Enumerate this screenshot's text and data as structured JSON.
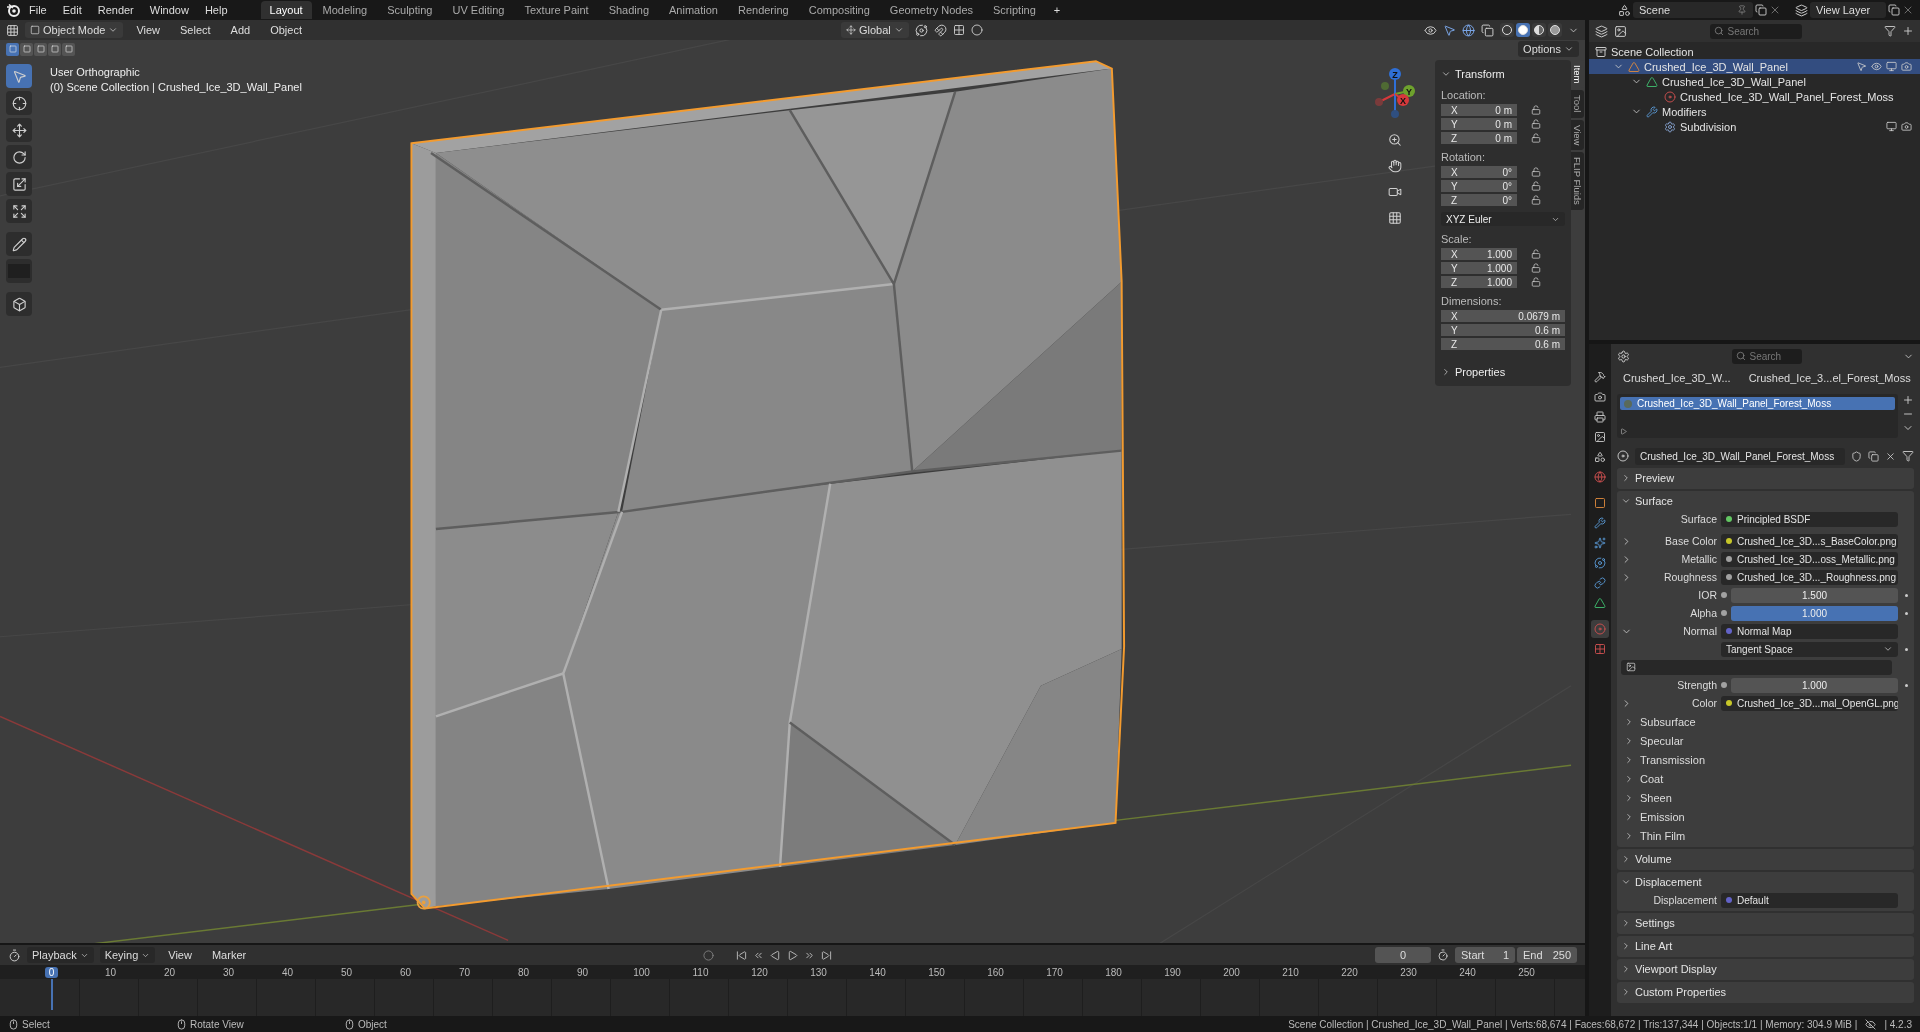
{
  "top_bar": {
    "menus": [
      "File",
      "Edit",
      "Render",
      "Window",
      "Help"
    ],
    "workspaces": [
      {
        "label": "Layout",
        "selected": true
      },
      {
        "label": "Modeling",
        "selected": false
      },
      {
        "label": "Sculpting",
        "selected": false
      },
      {
        "label": "UV Editing",
        "selected": false
      },
      {
        "label": "Texture Paint",
        "selected": false
      },
      {
        "label": "Shading",
        "selected": false
      },
      {
        "label": "Animation",
        "selected": false
      },
      {
        "label": "Rendering",
        "selected": false
      },
      {
        "label": "Compositing",
        "selected": false
      },
      {
        "label": "Geometry Nodes",
        "selected": false
      },
      {
        "label": "Scripting",
        "selected": false
      }
    ],
    "add_workspace": "+",
    "scene": "Scene",
    "view_layer": "View Layer"
  },
  "viewport": {
    "header": {
      "mode": "Object Mode",
      "menus": [
        "View",
        "Select",
        "Add",
        "Object"
      ],
      "orientation": "Global",
      "options": "Options"
    },
    "shading_modes": [
      {
        "kind": "wireframe",
        "selected": false
      },
      {
        "kind": "solid",
        "selected": true
      },
      {
        "kind": "material",
        "selected": false
      },
      {
        "kind": "rendered",
        "selected": false
      }
    ],
    "select_modes": [
      {
        "selected": true
      },
      {
        "selected": false
      },
      {
        "selected": false
      },
      {
        "selected": false
      },
      {
        "selected": false
      }
    ],
    "tools": [
      {
        "kind": "select",
        "selected": true
      },
      {
        "kind": "cursor",
        "selected": false
      },
      {
        "kind": "move",
        "selected": false
      },
      {
        "kind": "rotate",
        "selected": false
      },
      {
        "kind": "scale",
        "selected": false
      },
      {
        "kind": "transform",
        "selected": false
      },
      {
        "kind": "annotate",
        "selected": false
      },
      {
        "kind": "measure",
        "selected": false
      },
      {
        "kind": "add-cube",
        "selected": false
      }
    ],
    "view_name": "User Orthographic",
    "context": "(0) Scene Collection | Crushed_Ice_3D_Wall_Panel",
    "gizmo_axes": [
      {
        "label": "Z",
        "color": "#2f6fd6"
      },
      {
        "label": "Y",
        "color": "#6ea22d"
      },
      {
        "label": "X",
        "color": "#d7383b"
      }
    ],
    "sidebar": {
      "title": "Transform",
      "expanded": true,
      "groups": [
        {
          "kind": "vector",
          "label": "Location:",
          "fields": [
            {
              "axis": "X",
              "value": "0 m",
              "locked": false
            },
            {
              "axis": "Y",
              "value": "0 m",
              "locked": false
            },
            {
              "axis": "Z",
              "value": "0 m",
              "locked": false
            }
          ]
        },
        {
          "kind": "vector",
          "label": "Rotation:",
          "fields": [
            {
              "axis": "X",
              "value": "0°",
              "locked": false
            },
            {
              "axis": "Y",
              "value": "0°",
              "locked": false
            },
            {
              "axis": "Z",
              "value": "0°",
              "locked": false
            }
          ]
        },
        {
          "kind": "dropdown",
          "value": "XYZ Euler"
        },
        {
          "kind": "vector",
          "label": "Scale:",
          "fields": [
            {
              "axis": "X",
              "value": "1.000",
              "locked": false
            },
            {
              "axis": "Y",
              "value": "1.000",
              "locked": false
            },
            {
              "axis": "Z",
              "value": "1.000",
              "locked": false
            }
          ]
        },
        {
          "kind": "vector",
          "label": "Dimensions:",
          "fields": [
            {
              "axis": "X",
              "value": "0.0679 m"
            },
            {
              "axis": "Y",
              "value": "0.6 m"
            },
            {
              "axis": "Z",
              "value": "0.6 m"
            }
          ]
        }
      ],
      "properties": {
        "title": "Properties",
        "expanded": false
      }
    },
    "sidebar_tabs": [
      {
        "label": "Item",
        "selected": true
      },
      {
        "label": "Tool",
        "selected": false
      },
      {
        "label": "View",
        "selected": false
      },
      {
        "label": "FLIP Fluids",
        "selected": false
      }
    ]
  },
  "outliner": {
    "search": {
      "placeholder": "Search"
    },
    "tree": [
      {
        "kind": "collection",
        "label": "Scene Collection",
        "selected": false,
        "children": [
          {
            "kind": "object",
            "label": "Crushed_Ice_3D_Wall_Panel",
            "selected": true,
            "expanded": true,
            "children": [
              {
                "kind": "mesh",
                "label": "Crushed_Ice_3D_Wall_Panel",
                "selected": false,
                "expanded": true,
                "children": [
                  {
                    "kind": "material",
                    "label": "Crushed_Ice_3D_Wall_Panel_Forest_Moss",
                    "selected": false
                  }
                ]
              },
              {
                "kind": "modifiers",
                "label": "Modifiers",
                "selected": false,
                "expanded": true,
                "children": [
                  {
                    "kind": "modifier",
                    "label": "Subdivision",
                    "selected": false
                  }
                ]
              }
            ]
          }
        ]
      }
    ]
  },
  "properties": {
    "search": {
      "placeholder": "Search"
    },
    "tabs": [
      {
        "kind": "tool",
        "selected": false
      },
      {
        "kind": "render",
        "selected": false
      },
      {
        "kind": "output",
        "selected": false
      },
      {
        "kind": "view-layer",
        "selected": false
      },
      {
        "kind": "scene",
        "selected": false
      },
      {
        "kind": "world",
        "selected": false
      },
      {
        "kind": "object",
        "selected": false
      },
      {
        "kind": "modifiers",
        "selected": false
      },
      {
        "kind": "particles",
        "selected": false
      },
      {
        "kind": "physics",
        "selected": false
      },
      {
        "kind": "constraints",
        "selected": false
      },
      {
        "kind": "data",
        "selected": false
      },
      {
        "kind": "material",
        "selected": true
      },
      {
        "kind": "texture",
        "selected": false
      }
    ],
    "breadcrumb": [
      "Crushed_Ice_3D_W...",
      "Crushed_Ice_3...el_Forest_Moss"
    ],
    "material_slots": [
      {
        "label": "Crushed_Ice_3D_Wall_Panel_Forest_Moss",
        "selected": true
      }
    ],
    "material_name": "Crushed_Ice_3D_Wall_Panel_Forest_Moss",
    "panels": [
      {
        "title": "Preview",
        "expanded": false
      },
      {
        "title": "Surface",
        "expanded": true,
        "rows": [
          {
            "kind": "link",
            "label": "Surface",
            "value": "Principled BSDF",
            "color": "#63c763"
          },
          {
            "kind": "link",
            "label": "Base Color",
            "value": "Crushed_Ice_3D...s_BaseColor.png",
            "color": "#c7c729",
            "expanded": false
          },
          {
            "kind": "link",
            "label": "Metallic",
            "value": "Crushed_Ice_3D...oss_Metallic.png",
            "color": "#a1a1a1",
            "expanded": false
          },
          {
            "kind": "link",
            "label": "Roughness",
            "value": "Crushed_Ice_3D..._Roughness.png",
            "color": "#a1a1a1",
            "expanded": false
          },
          {
            "kind": "number",
            "label": "IOR",
            "value": "1.500",
            "color": "#a1a1a1"
          },
          {
            "kind": "slider",
            "label": "Alpha",
            "value": "1.000",
            "color": "#a1a1a1",
            "level": 1
          },
          {
            "kind": "link",
            "label": "Normal",
            "value": "Normal Map",
            "color": "#6363c7",
            "expanded": true
          },
          {
            "kind": "dropdown",
            "value": "Tangent Space"
          },
          {
            "kind": "image"
          },
          {
            "kind": "number",
            "label": "Strength",
            "value": "1.000",
            "color": "#a1a1a1"
          },
          {
            "kind": "link",
            "label": "Color",
            "value": "Crushed_Ice_3D...mal_OpenGL.png",
            "color": "#c7c729",
            "expanded": false
          }
        ],
        "subsections": [
          {
            "title": "Subsurface",
            "expanded": false
          },
          {
            "title": "Specular",
            "expanded": false
          },
          {
            "title": "Transmission",
            "expanded": false
          },
          {
            "title": "Coat",
            "expanded": false
          },
          {
            "title": "Sheen",
            "expanded": false
          },
          {
            "title": "Emission",
            "expanded": false
          },
          {
            "title": "Thin Film",
            "expanded": false
          }
        ]
      },
      {
        "title": "Volume",
        "expanded": false
      },
      {
        "title": "Displacement",
        "expanded": true,
        "rows": [
          {
            "kind": "link",
            "label": "Displacement",
            "value": "Default",
            "color": "#6363c7"
          }
        ]
      },
      {
        "title": "Settings",
        "expanded": false
      },
      {
        "title": "Line Art",
        "expanded": false
      },
      {
        "title": "Viewport Display",
        "expanded": false
      },
      {
        "title": "Custom Properties",
        "expanded": false
      }
    ]
  },
  "timeline": {
    "menus": [
      "Playback",
      "Keying",
      "View",
      "Marker"
    ],
    "playhead": "0",
    "ruler": [
      "10",
      "20",
      "30",
      "40",
      "50",
      "60",
      "70",
      "80",
      "90",
      "100",
      "110",
      "120",
      "130",
      "140",
      "150",
      "160",
      "170",
      "180",
      "190",
      "200",
      "210",
      "220",
      "230",
      "240",
      "250"
    ],
    "current_frame": "0",
    "start_label": "Start",
    "start": "1",
    "end_label": "End",
    "end": "250"
  },
  "status_bar": {
    "hints": [
      "Select",
      "Rotate View",
      "Object"
    ],
    "stats": "Scene Collection | Crushed_Ice_3D_Wall_Panel | Verts:68,674 | Faces:68,672 | Tris:137,344 | Objects:1/1 | Memory: 304.9 MiB |",
    "version": "| 4.2.3"
  }
}
